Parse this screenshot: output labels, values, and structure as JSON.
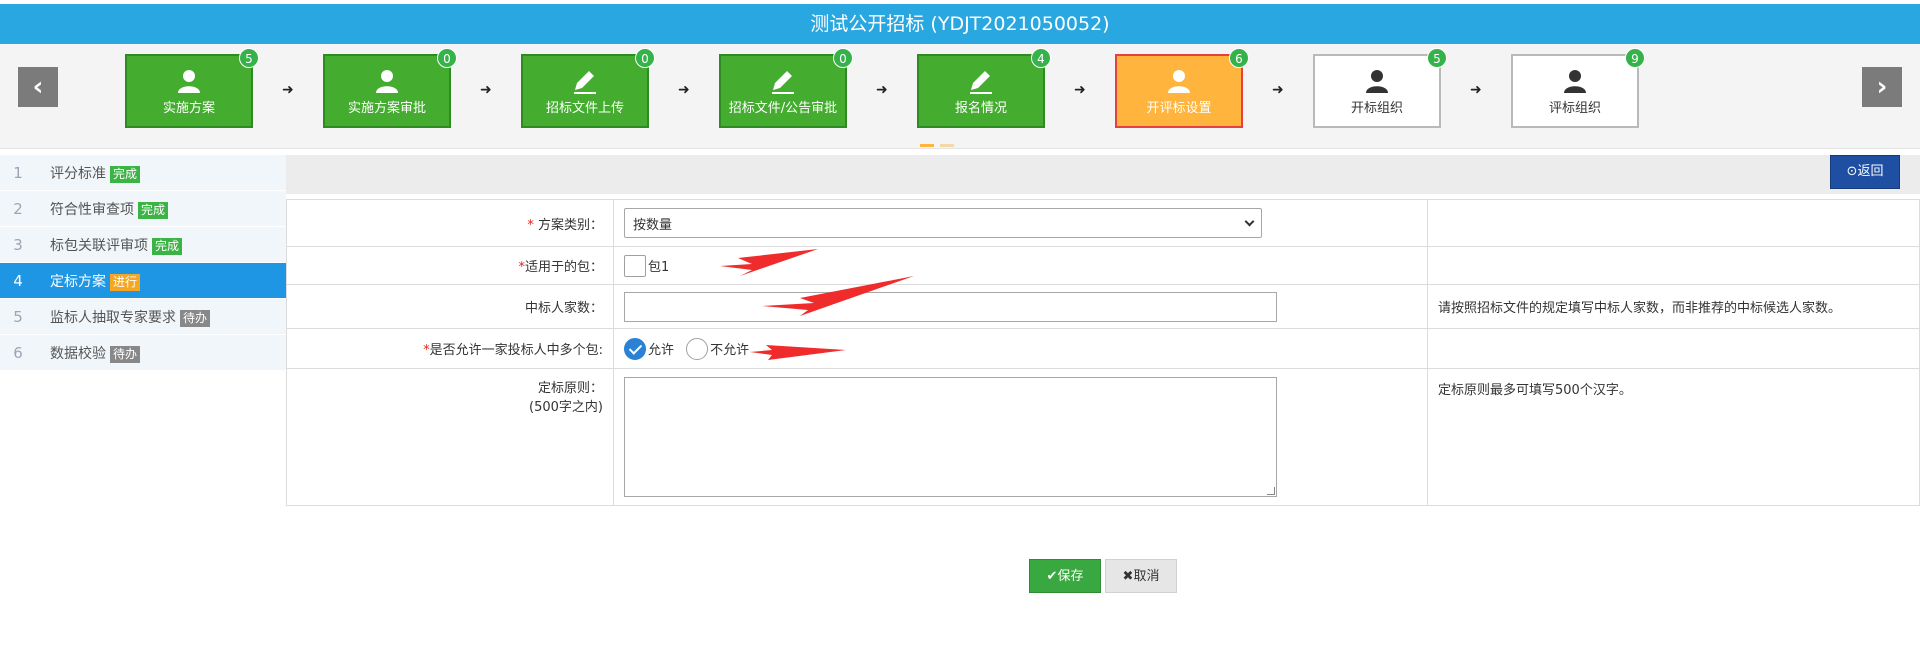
{
  "page": {
    "title": "测试公开招标 (YDJT2021050052)"
  },
  "nav": {
    "prev_label": "‹",
    "next_label": "›"
  },
  "steps": [
    {
      "label": "实施方案",
      "count": "5",
      "state": "done",
      "icon": "user-icon"
    },
    {
      "label": "实施方案审批",
      "count": "0",
      "state": "done",
      "icon": "user-icon"
    },
    {
      "label": "招标文件上传",
      "count": "0",
      "state": "done",
      "icon": "pencil-icon"
    },
    {
      "label": "招标文件/公告审批",
      "count": "0",
      "state": "done",
      "icon": "pencil-icon"
    },
    {
      "label": "报名情况",
      "count": "4",
      "state": "done",
      "icon": "pencil-icon"
    },
    {
      "label": "开评标设置",
      "count": "6",
      "state": "current",
      "icon": "user-icon"
    },
    {
      "label": "开标组织",
      "count": "5",
      "state": "pending",
      "icon": "user-icon"
    },
    {
      "label": "评标组织",
      "count": "9",
      "state": "pending",
      "icon": "user-icon"
    }
  ],
  "arrow_glyph": "➜",
  "menu": [
    {
      "num": "1",
      "label": "评分标准",
      "status": "完成",
      "status_type": "done"
    },
    {
      "num": "2",
      "label": "符合性审查项",
      "status": "完成",
      "status_type": "done"
    },
    {
      "num": "3",
      "label": "标包关联评审项",
      "status": "完成",
      "status_type": "done"
    },
    {
      "num": "4",
      "label": "定标方案",
      "status": "进行",
      "status_type": "running"
    },
    {
      "num": "5",
      "label": "监标人抽取专家要求",
      "status": "待办",
      "status_type": "todo"
    },
    {
      "num": "6",
      "label": "数据校验",
      "status": "待办",
      "status_type": "todo"
    }
  ],
  "back_button": "⊙返回",
  "form": {
    "scheme_type": {
      "required_mark": "*",
      "label": " 方案类别：",
      "value": "按数量"
    },
    "package": {
      "required_mark": "*",
      "label": "适用于的包：",
      "option": "包1"
    },
    "winner_count": {
      "label": "中标人家数：",
      "value": "",
      "hint": "请按照招标文件的规定填写中标人家数，而非推荐的中标候选人家数。"
    },
    "multi_package": {
      "required_mark": "*",
      "label": "是否允许一家投标人中多个包:",
      "option_yes": "允许",
      "option_no": "不允许",
      "selected": "允许"
    },
    "principle": {
      "label_line1": "定标原则：",
      "label_line2": "(500字之内)",
      "value": "",
      "hint": "定标原则最多可填写500个汉字。"
    }
  },
  "actions": {
    "save": "✔保存",
    "cancel": "✖取消"
  },
  "colors": {
    "title_bar": "#29a7e1",
    "step_done": "#44ad2f",
    "step_current": "#feb43d",
    "menu_active": "#1e96e3",
    "save": "#3aa840",
    "back": "#1f4fa2"
  }
}
